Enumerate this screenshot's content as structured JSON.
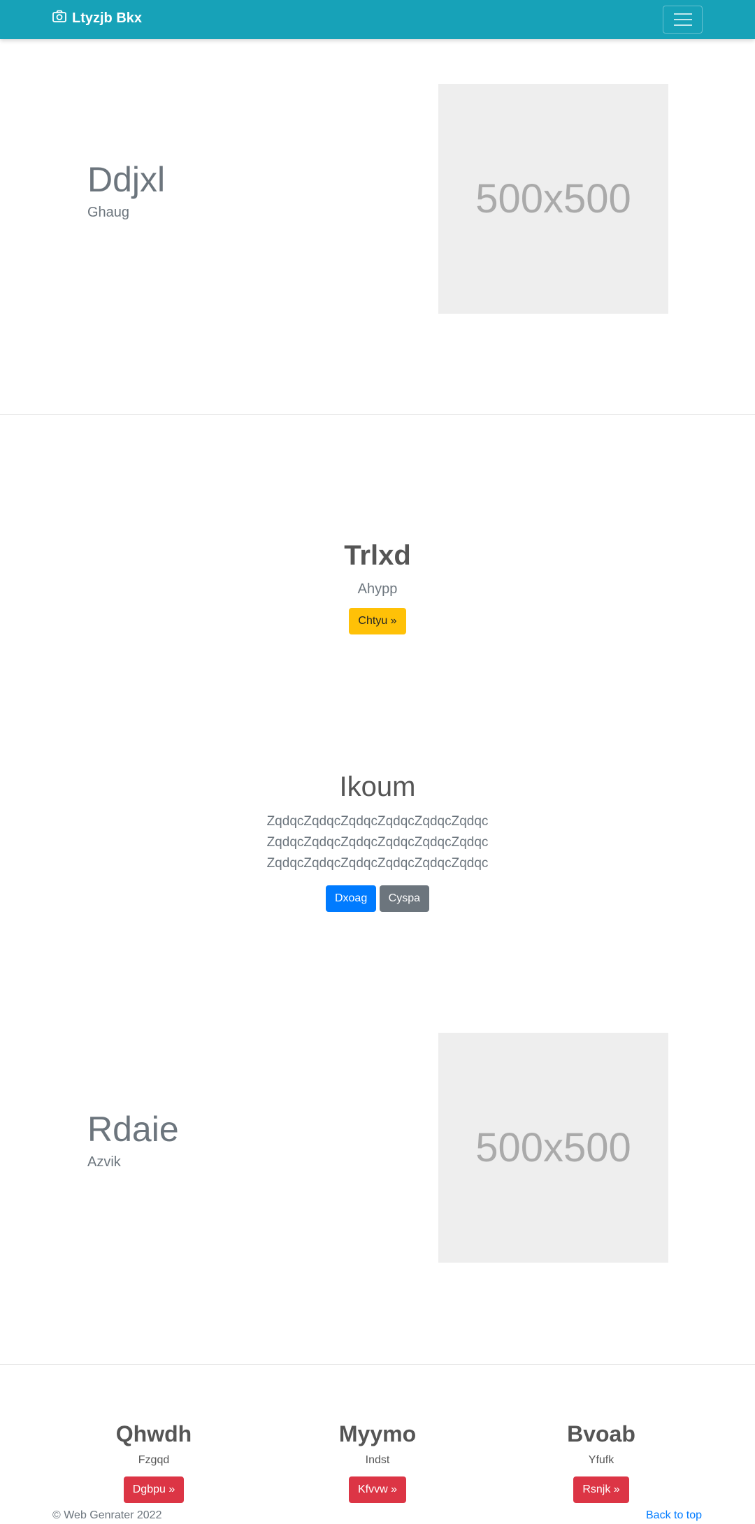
{
  "navbar": {
    "brand": "Ltyzjb Bkx",
    "brand_icon": "camera-icon",
    "menu_icon": "hamburger-icon"
  },
  "feature1": {
    "title": "Ddjxl",
    "subtitle": "Ghaug",
    "image_label": "500x500"
  },
  "hero1": {
    "title": "Trlxd",
    "subtitle": "Ahypp",
    "button": "Chtyu »"
  },
  "hero2": {
    "title": "Ikoum",
    "lines": [
      "ZqdqcZqdqcZqdqcZqdqcZqdqcZqdqc",
      "ZqdqcZqdqcZqdqcZqdqcZqdqcZqdqc",
      "ZqdqcZqdqcZqdqcZqdqcZqdqcZqdqc"
    ],
    "primary_button": "Dxoag",
    "secondary_button": "Cyspa"
  },
  "feature2": {
    "title": "Rdaie",
    "subtitle": "Azvik",
    "image_label": "500x500"
  },
  "columns": [
    {
      "title": "Qhwdh",
      "text": "Fzgqd",
      "button": "Dgbpu »"
    },
    {
      "title": "Myymo",
      "text": "Indst",
      "button": "Kfvvw »"
    },
    {
      "title": "Bvoab",
      "text": "Yfufk",
      "button": "Rsnjk »"
    }
  ],
  "footer": {
    "copyright": "© Web Genrater 2022",
    "back_to_top": "Back to top"
  },
  "colors": {
    "navbar": "#17a2b8",
    "warning": "#ffc107",
    "primary": "#007bff",
    "secondary": "#6c757d",
    "danger": "#dc3545"
  }
}
